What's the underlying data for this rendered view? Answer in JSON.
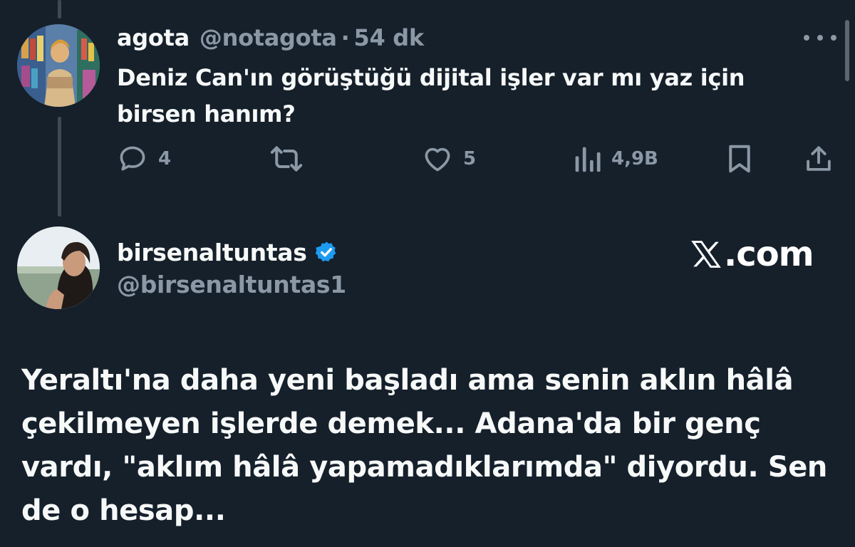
{
  "reply": {
    "display_name": "agota",
    "handle": "@notagota",
    "separator": "·",
    "time": "54 dk",
    "text_line1": "Deniz Can'ın görüştüğü dijital işler var mı yaz için",
    "text_line2": "birsen hanım?",
    "actions": {
      "reply_count": "4",
      "retweet_count": "",
      "like_count": "5",
      "views_count": "4,9B"
    },
    "icons": {
      "more": "more-horizontal-icon",
      "reply": "speech-bubble-icon",
      "retweet": "retweet-icon",
      "like": "heart-icon",
      "views": "bar-chart-icon",
      "bookmark": "bookmark-icon",
      "share": "share-upload-icon"
    }
  },
  "author": {
    "display_name": "birsenaltuntas",
    "handle": "@birsenaltuntas1",
    "verified_icon": "verified-badge-icon"
  },
  "brand": {
    "domain_suffix": ".com",
    "logo_icon": "x-logo-icon"
  },
  "post": {
    "line1": "Yeraltı'na daha yeni başladı ama senin aklın hâlâ",
    "line2": "çekilmeyen işlerde demek... Adana'da bir genç",
    "line3": "vardı, \"aklım hâlâ yapamadıklarımda\" diyordu. Sen",
    "line4": "de o hesap..."
  },
  "colors": {
    "background": "#15202b",
    "primary_text": "#f7f9f9",
    "secondary_text": "#8b98a5",
    "thread_line": "#3d4a56",
    "verified_blue": "#1d9bf0"
  }
}
